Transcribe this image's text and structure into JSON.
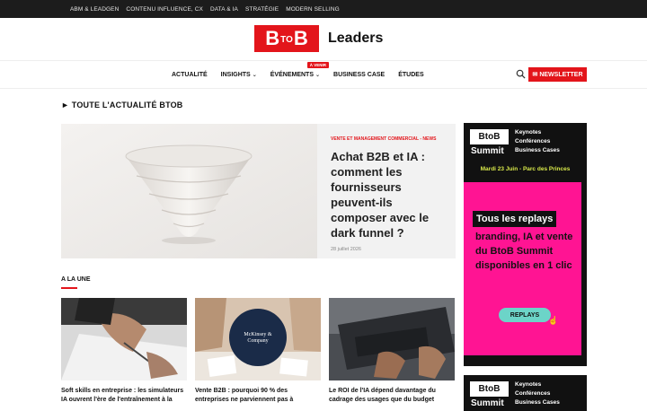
{
  "topbar": {
    "links": [
      "ABM & LEADGEN",
      "CONTENU INFLUENCE, CX",
      "DATA & IA",
      "STRATÉGIE",
      "MODERN SELLING"
    ]
  },
  "logo": {
    "b1": "B",
    "to": "TO",
    "b2": "B",
    "text": "Leaders"
  },
  "nav": {
    "items": [
      "ACTUALITÉ",
      "INSIGHTS",
      "ÉVÉNEMENTS",
      "BUSINESS CASE",
      "ÉTUDES"
    ],
    "badge": "À VENIR",
    "chevron": "⌄",
    "newsletter": "NEWSLETTER",
    "newsletter_icon": "✉"
  },
  "section": {
    "title": "► TOUTE L'ACTUALITÉ BTOB"
  },
  "hero": {
    "category": "VENTE ET MANAGEMENT COMMERCIAL - NEWS",
    "title": "Achat B2B et IA : comment les fournisseurs peuvent-ils composer avec le dark funnel ?",
    "date": "28 juillet 2026"
  },
  "alaune": {
    "title": "A LA UNE"
  },
  "cards": [
    {
      "title": "Soft skills en entreprise : les simulateurs IA ouvrent l'ère de l'entraînement à la"
    },
    {
      "title": "Vente B2B : pourquoi 90 % des entreprises ne parviennent pas à",
      "logo": "McKinsey & Company"
    },
    {
      "title": "Le ROI de l'IA dépend davantage du cadrage des usages que du budget"
    }
  ],
  "ad": {
    "logo": "BtoB",
    "summit": "Summit",
    "lines": [
      "Keynotes",
      "Conférences",
      "Business Cases"
    ],
    "date": "Mardi 23 Juin - Parc des Princes",
    "replays": "Tous les replays",
    "body": "branding, IA et vente du BtoB Summit disponibles en 1 clic",
    "button": "REPLAYS",
    "cursor": "☝"
  },
  "ad2": {
    "logo": "BtoB",
    "summit": "Summit",
    "lines": [
      "Keynotes",
      "Conférences",
      "Business Cases"
    ]
  },
  "colors": {
    "brand": "#e3151b",
    "topbar": "#1c1c1c",
    "ad_pink": "#ff1493",
    "ad_yellow": "#d8e84a",
    "ad_button": "#6cd4c8"
  }
}
